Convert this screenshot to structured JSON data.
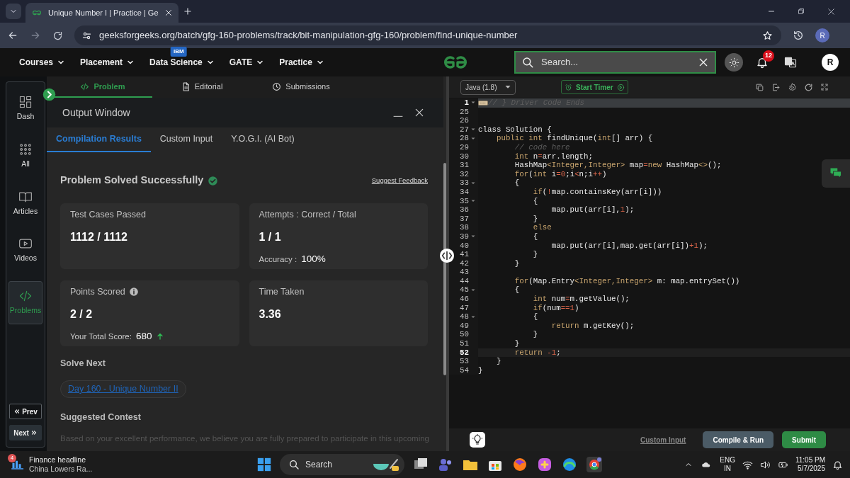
{
  "browser": {
    "tab_title": "Unique Number I | Practice | Ge",
    "url": "geeksforgeeks.org/batch/gfg-160-problems/track/bit-manipulation-gfg-160/problem/find-unique-number",
    "profile_initial": "R"
  },
  "site_nav": {
    "menus": [
      {
        "label": "Courses"
      },
      {
        "label": "Placement"
      },
      {
        "label": "Data Science",
        "badge": "IBM"
      },
      {
        "label": "GATE"
      },
      {
        "label": "Practice"
      }
    ],
    "search": {
      "placeholder": "Search..."
    },
    "notification_count": "12",
    "avatar_initial": "R"
  },
  "sidebar": {
    "items": [
      {
        "label": "Dash",
        "kind": "dash",
        "selected": false
      },
      {
        "label": "All",
        "kind": "all",
        "selected": false
      },
      {
        "label": "Articles",
        "kind": "articles",
        "selected": false
      },
      {
        "label": "Videos",
        "kind": "videos",
        "selected": false
      },
      {
        "label": "Problems",
        "kind": "problems",
        "selected": true
      }
    ],
    "pager": [
      {
        "label": "Prev",
        "kind": "prev"
      },
      {
        "label": "Next",
        "kind": "next"
      }
    ]
  },
  "problem_tabs": [
    {
      "label": "Problem",
      "kind": "code",
      "selected": true
    },
    {
      "label": "Editorial",
      "kind": "document",
      "selected": false
    },
    {
      "label": "Submissions",
      "kind": "clock",
      "selected": false
    }
  ],
  "output_window": {
    "title": "Output Window",
    "tabs": [
      {
        "label": "Compilation Results",
        "selected": true
      },
      {
        "label": "Custom Input",
        "selected": false
      },
      {
        "label": "Y.O.G.I. (AI Bot)",
        "selected": false
      }
    ],
    "heading": "Problem Solved Successfully",
    "feedback_link": "Suggest Feedback",
    "cards": [
      {
        "label": "Test Cases Passed",
        "value": "1112 / 1112",
        "info": false,
        "rising": false
      },
      {
        "label": "Attempts : Correct / Total",
        "value": "1 / 1",
        "info": false,
        "rising": false,
        "note_label": "Accuracy :",
        "note_value": "100%"
      },
      {
        "label": "Points Scored",
        "value": "2 / 2",
        "info": true,
        "rising": true,
        "note_label": "Your Total Score:",
        "note_value": "680"
      },
      {
        "label": "Time Taken",
        "value": "3.36",
        "info": false,
        "rising": false
      }
    ],
    "solve_next": {
      "title": "Solve Next",
      "link": "Day 160 - Unique Number II"
    },
    "contest": {
      "title": "Suggested Contest",
      "text": "Based on your excellent performance, we believe you are fully prepared to participate in this upcoming"
    }
  },
  "editor": {
    "language": "Java (1.8)",
    "timer_button": "Start Timer",
    "lines": [
      {
        "number": "1",
        "foldable": true,
        "active": true,
        "folded": true,
        "tokens": [
          {
            "kind": "comment",
            "text": "// } Driver Code Ends"
          }
        ]
      },
      {
        "number": "25",
        "foldable": false,
        "active": false,
        "folded": false
      },
      {
        "number": "26",
        "foldable": false,
        "active": false,
        "folded": false
      },
      {
        "number": "27",
        "foldable": true,
        "active": false,
        "folded": false,
        "tokens": [
          {
            "kind": "plain",
            "text": "class Solution {"
          }
        ]
      },
      {
        "number": "28",
        "foldable": true,
        "active": false,
        "folded": false,
        "tokens": [
          {
            "kind": "keyword",
            "text": "    public int"
          },
          {
            "kind": "plain",
            "text": " findUnique("
          },
          {
            "kind": "keyword",
            "text": "int"
          },
          {
            "kind": "plain",
            "text": "[] arr) {"
          }
        ]
      },
      {
        "number": "29",
        "foldable": false,
        "active": false,
        "folded": false,
        "tokens": [
          {
            "kind": "comment",
            "text": "        // code here"
          }
        ]
      },
      {
        "number": "30",
        "foldable": false,
        "active": false,
        "folded": false,
        "tokens": [
          {
            "kind": "keyword",
            "text": "        int"
          },
          {
            "kind": "plain",
            "text": " n"
          },
          {
            "kind": "operator",
            "text": "="
          },
          {
            "kind": "plain",
            "text": "arr.length;"
          }
        ]
      },
      {
        "number": "31",
        "foldable": false,
        "active": false,
        "folded": false,
        "tokens": [
          {
            "kind": "plain",
            "text": "        HashMap"
          },
          {
            "kind": "keyword",
            "text": "<Integer,Integer>"
          },
          {
            "kind": "plain",
            "text": " map"
          },
          {
            "kind": "operator",
            "text": "="
          },
          {
            "kind": "keyword",
            "text": "new"
          },
          {
            "kind": "plain",
            "text": " HashMap"
          },
          {
            "kind": "keyword",
            "text": "<>"
          },
          {
            "kind": "plain",
            "text": "();"
          }
        ]
      },
      {
        "number": "32",
        "foldable": false,
        "active": false,
        "folded": false,
        "tokens": [
          {
            "kind": "keyword",
            "text": "        for"
          },
          {
            "kind": "plain",
            "text": "("
          },
          {
            "kind": "keyword",
            "text": "int"
          },
          {
            "kind": "plain",
            "text": " i"
          },
          {
            "kind": "operator",
            "text": "="
          },
          {
            "kind": "operator",
            "text": "0"
          },
          {
            "kind": "plain",
            "text": ";i"
          },
          {
            "kind": "operator",
            "text": "<"
          },
          {
            "kind": "plain",
            "text": "n;i"
          },
          {
            "kind": "operator",
            "text": "++"
          },
          {
            "kind": "plain",
            "text": ")"
          }
        ]
      },
      {
        "number": "33",
        "foldable": true,
        "active": false,
        "folded": false,
        "tokens": [
          {
            "kind": "plain",
            "text": "        {"
          }
        ]
      },
      {
        "number": "34",
        "foldable": false,
        "active": false,
        "folded": false,
        "tokens": [
          {
            "kind": "keyword",
            "text": "            if"
          },
          {
            "kind": "plain",
            "text": "("
          },
          {
            "kind": "operator",
            "text": "!"
          },
          {
            "kind": "plain",
            "text": "map.containsKey(arr[i]))"
          }
        ]
      },
      {
        "number": "35",
        "foldable": true,
        "active": false,
        "folded": false,
        "tokens": [
          {
            "kind": "plain",
            "text": "            {"
          }
        ]
      },
      {
        "number": "36",
        "foldable": false,
        "active": false,
        "folded": false,
        "tokens": [
          {
            "kind": "plain",
            "text": "                map.put(arr[i],"
          },
          {
            "kind": "operator",
            "text": "1"
          },
          {
            "kind": "plain",
            "text": ");"
          }
        ]
      },
      {
        "number": "37",
        "foldable": false,
        "active": false,
        "folded": false,
        "tokens": [
          {
            "kind": "plain",
            "text": "            }"
          }
        ]
      },
      {
        "number": "38",
        "foldable": false,
        "active": false,
        "folded": false,
        "tokens": [
          {
            "kind": "keyword",
            "text": "            else"
          }
        ]
      },
      {
        "number": "39",
        "foldable": true,
        "active": false,
        "folded": false,
        "tokens": [
          {
            "kind": "plain",
            "text": "            {"
          }
        ]
      },
      {
        "number": "40",
        "foldable": false,
        "active": false,
        "folded": false,
        "tokens": [
          {
            "kind": "plain",
            "text": "                map.put(arr[i],map.get(arr[i])"
          },
          {
            "kind": "operator",
            "text": "+1"
          },
          {
            "kind": "plain",
            "text": ");"
          }
        ]
      },
      {
        "number": "41",
        "foldable": false,
        "active": false,
        "folded": false,
        "tokens": [
          {
            "kind": "plain",
            "text": "            }"
          }
        ]
      },
      {
        "number": "42",
        "foldable": false,
        "active": false,
        "folded": false,
        "tokens": [
          {
            "kind": "plain",
            "text": "        }"
          }
        ]
      },
      {
        "number": "43",
        "foldable": false,
        "active": false,
        "folded": false
      },
      {
        "number": "44",
        "foldable": false,
        "active": false,
        "folded": false,
        "tokens": [
          {
            "kind": "keyword",
            "text": "        for"
          },
          {
            "kind": "plain",
            "text": "(Map.Entry"
          },
          {
            "kind": "keyword",
            "text": "<Integer,Integer>"
          },
          {
            "kind": "plain",
            "text": " m: map.entrySet())"
          }
        ]
      },
      {
        "number": "45",
        "foldable": true,
        "active": false,
        "folded": false,
        "tokens": [
          {
            "kind": "plain",
            "text": "        {"
          }
        ]
      },
      {
        "number": "46",
        "foldable": false,
        "active": false,
        "folded": false,
        "tokens": [
          {
            "kind": "keyword",
            "text": "            int"
          },
          {
            "kind": "plain",
            "text": " num"
          },
          {
            "kind": "operator",
            "text": "="
          },
          {
            "kind": "plain",
            "text": "m.getValue();"
          }
        ]
      },
      {
        "number": "47",
        "foldable": false,
        "active": false,
        "folded": false,
        "tokens": [
          {
            "kind": "keyword",
            "text": "            if"
          },
          {
            "kind": "plain",
            "text": "(num"
          },
          {
            "kind": "operator",
            "text": "==1"
          },
          {
            "kind": "plain",
            "text": ")"
          }
        ]
      },
      {
        "number": "48",
        "foldable": true,
        "active": false,
        "folded": false,
        "tokens": [
          {
            "kind": "plain",
            "text": "            {"
          }
        ]
      },
      {
        "number": "49",
        "foldable": false,
        "active": false,
        "folded": false,
        "tokens": [
          {
            "kind": "keyword",
            "text": "                return"
          },
          {
            "kind": "plain",
            "text": " m.getKey();"
          }
        ]
      },
      {
        "number": "50",
        "foldable": false,
        "active": false,
        "folded": false,
        "tokens": [
          {
            "kind": "plain",
            "text": "            }"
          }
        ]
      },
      {
        "number": "51",
        "foldable": false,
        "active": false,
        "folded": false,
        "tokens": [
          {
            "kind": "plain",
            "text": "        }"
          }
        ]
      },
      {
        "number": "52",
        "foldable": false,
        "active": true,
        "folded": false,
        "tokens": [
          {
            "kind": "keyword",
            "text": "        return"
          },
          {
            "kind": "operator",
            "text": " -1"
          },
          {
            "kind": "plain",
            "text": ";"
          }
        ]
      },
      {
        "number": "53",
        "foldable": false,
        "active": false,
        "folded": false,
        "tokens": [
          {
            "kind": "plain",
            "text": "    }"
          }
        ]
      },
      {
        "number": "54",
        "foldable": false,
        "active": false,
        "folded": false,
        "tokens": [
          {
            "kind": "plain",
            "text": "}"
          }
        ]
      }
    ],
    "custom_input_link": "Custom Input",
    "buttons": [
      {
        "label": "Compile & Run",
        "kind": "secondary"
      },
      {
        "label": "Submit",
        "kind": "primary"
      }
    ]
  },
  "taskbar": {
    "news": {
      "badge": "4",
      "title": "Finance headline",
      "subtitle": "China Lowers Ra..."
    },
    "search_label": "Search",
    "language": "ENG",
    "region": "IN",
    "time": "11:05 PM",
    "date": "5/7/2025"
  }
}
